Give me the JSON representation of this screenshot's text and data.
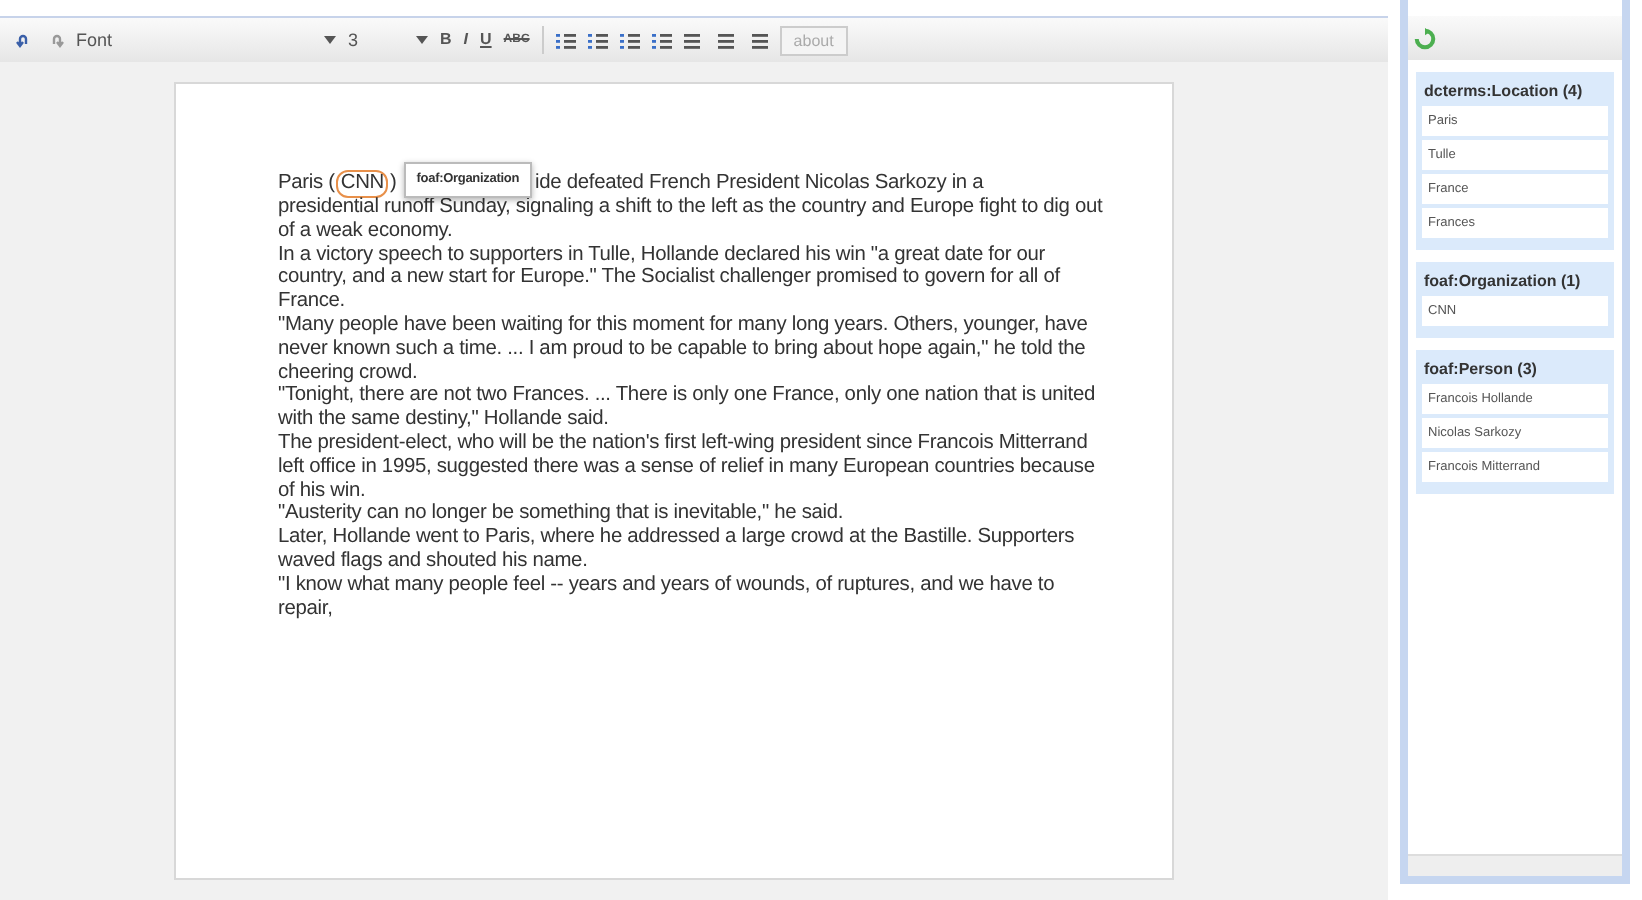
{
  "toolbar": {
    "font": "Font",
    "size": "3",
    "format": [
      {
        "kind": "bold",
        "label": "B"
      },
      {
        "kind": "italic",
        "label": "I"
      },
      {
        "kind": "underline",
        "label": "U"
      },
      {
        "kind": "strike",
        "label": "ABC"
      }
    ],
    "about": "about"
  },
  "document": {
    "lead": {
      "before": "Paris (",
      "entity": "CNN",
      "after": ")",
      "tooltip": "foaf:Organization",
      "line_rest": "ide defeated French President Nicolas Sarkozy in a",
      "continuation": "presidential runoff Sunday, signaling a shift to the left as the country and Europe fight to dig out of a weak economy."
    },
    "paragraphs": [
      "In a victory speech to supporters in Tulle, Hollande declared his win \"a great date for our country, and a new start for Europe.\" The Socialist challenger promised to govern for all of France.",
      "\"Many people have been waiting for this moment for many long years. Others, younger, have never known such a time. ... I am proud to be capable to bring about hope again,\" he told the cheering crowd.",
      "\"Tonight, there are not two Frances. ... There is only one France, only one nation that is united with the same destiny,\" Hollande said.",
      "The president-elect, who will be the nation's first left-wing president since Francois Mitterrand left office in 1995, suggested there was a sense of relief in many European countries because of his win.",
      "\"Austerity can no longer be something that is inevitable,\" he said.",
      "Later, Hollande went to Paris, where he addressed a large crowd at the Bastille. Supporters waved flags and shouted his name.",
      "\"I know what many people feel -- years and years of wounds, of ruptures, and we have to repair,"
    ]
  },
  "entities": [
    {
      "title": "dcterms:Location (4)",
      "items": [
        "Paris",
        "Tulle",
        "France",
        "Frances"
      ]
    },
    {
      "title": "foaf:Organization (1)",
      "items": [
        "CNN"
      ]
    },
    {
      "title": "foaf:Person (3)",
      "items": [
        "Francois Hollande",
        "Nicolas Sarkozy",
        "Francois Mitterrand"
      ]
    }
  ]
}
